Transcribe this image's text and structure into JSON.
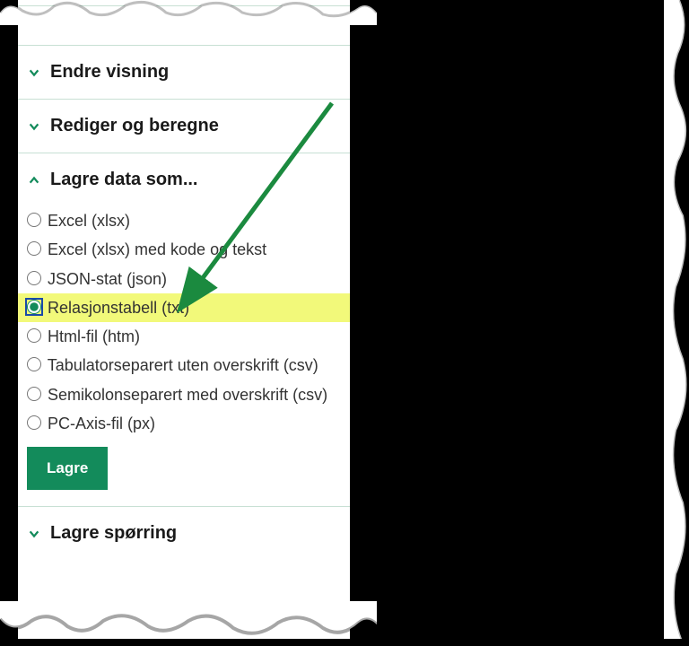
{
  "sections": {
    "partial_top": {
      "title": ""
    },
    "endre_visning": {
      "title": "Endre visning"
    },
    "rediger": {
      "title": "Rediger og beregne"
    },
    "lagre_data": {
      "title": "Lagre data som..."
    },
    "lagre_sporring": {
      "title": "Lagre spørring"
    }
  },
  "formats": [
    {
      "label": "Excel (xlsx)"
    },
    {
      "label": "Excel (xlsx) med kode og tekst"
    },
    {
      "label": "JSON-stat (json)"
    },
    {
      "label": "Relasjonstabell (txt)"
    },
    {
      "label": "Html-fil (htm)"
    },
    {
      "label": "Tabulatorseparert uten overskrift (csv)"
    },
    {
      "label": "Semikolonseparert med overskrift (csv)"
    },
    {
      "label": "PC-Axis-fil (px)"
    }
  ],
  "selected_format_index": 3,
  "buttons": {
    "save": "Lagre"
  },
  "colors": {
    "accent": "#138b5b",
    "highlight": "#f2f97a"
  }
}
